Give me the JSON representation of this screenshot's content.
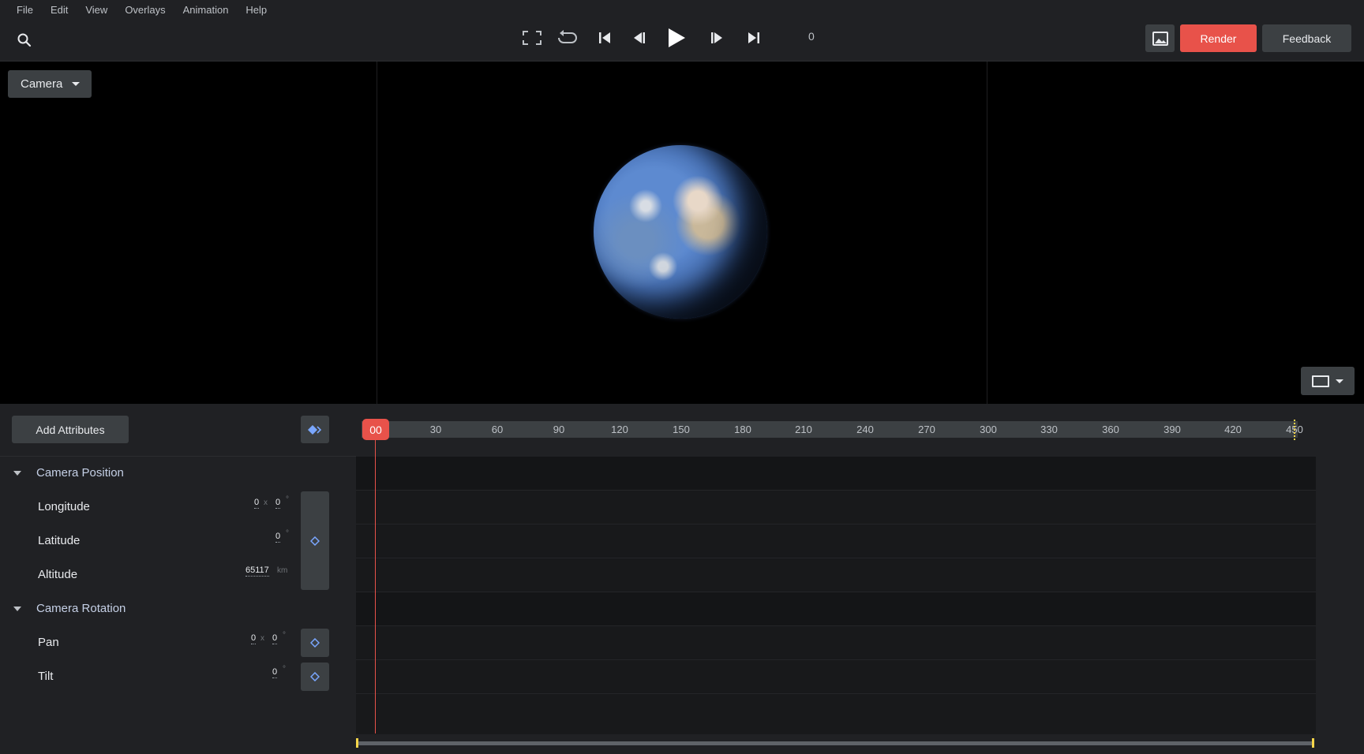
{
  "menu": [
    "File",
    "Edit",
    "View",
    "Overlays",
    "Animation",
    "Help"
  ],
  "toolbar": {
    "frame": "0",
    "render_label": "Render",
    "feedback_label": "Feedback"
  },
  "viewport": {
    "camera_label": "Camera"
  },
  "panel": {
    "add_attributes_label": "Add Attributes",
    "playhead_label": "00",
    "ticks": [
      "30",
      "60",
      "90",
      "120",
      "150",
      "180",
      "210",
      "240",
      "270",
      "300",
      "330",
      "360",
      "390",
      "420",
      "450"
    ],
    "camera_position": {
      "title": "Camera Position",
      "longitude": {
        "label": "Longitude",
        "v1": "0",
        "sep": "x",
        "v2": "0",
        "unit": "°"
      },
      "latitude": {
        "label": "Latitude",
        "v": "0",
        "unit": "°"
      },
      "altitude": {
        "label": "Altitude",
        "v": "65117",
        "unit": "km"
      }
    },
    "camera_rotation": {
      "title": "Camera Rotation",
      "pan": {
        "label": "Pan",
        "v1": "0",
        "sep": "x",
        "v2": "0",
        "unit": "°"
      },
      "tilt": {
        "label": "Tilt",
        "v": "0",
        "unit": "°"
      }
    }
  },
  "colors": {
    "accent_red": "#e8524a",
    "keyframe_blue": "#7aa7ff",
    "marker_yellow": "#f6d64a"
  }
}
